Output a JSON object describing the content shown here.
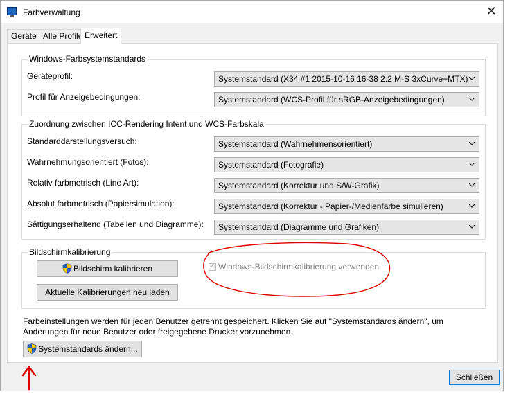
{
  "window": {
    "title": "Farbverwaltung",
    "close_glyph": "✕"
  },
  "tabs": [
    {
      "label": "Geräte"
    },
    {
      "label": "Alle Profile"
    },
    {
      "label": "Erweitert"
    }
  ],
  "wcs_group": {
    "title": "Windows-Farbsystemstandards",
    "rows": [
      {
        "label": "Geräteprofil:",
        "value": "Systemstandard (X34 #1 2015-10-16 16-38 2.2 M-S 3xCurve+MTX)"
      },
      {
        "label": "Profil für Anzeigebedingungen:",
        "value": "Systemstandard (WCS-Profil für sRGB-Anzeigebedingungen)"
      }
    ]
  },
  "icc_group": {
    "title": "Zuordnung zwischen ICC-Rendering Intent und WCS-Farbskala",
    "rows": [
      {
        "label": "Standarddarstellungsversuch:",
        "value": "Systemstandard (Wahrnehmensorientiert)"
      },
      {
        "label": "Wahrnehmungsorientiert (Fotos):",
        "value": "Systemstandard (Fotografie)"
      },
      {
        "label": "Relativ farbmetrisch (Line Art):",
        "value": "Systemstandard (Korrektur und S/W-Grafik)"
      },
      {
        "label": "Absolut farbmetrisch (Papiersimulation):",
        "value": "Systemstandard (Korrektur - Papier-/Medienfarbe simulieren)"
      },
      {
        "label": "Sättigungserhaltend (Tabellen und Diagramme):",
        "value": "Systemstandard (Diagramme und Grafiken)"
      }
    ]
  },
  "calibration_group": {
    "title": "Bildschirmkalibrierung",
    "calibrate_button": "Bildschirm kalibrieren",
    "reload_button": "Aktuelle Kalibrierungen neu laden",
    "use_windows_calibration_label": "Windows-Bildschirmkalibrierung verwenden",
    "use_windows_calibration_checked": true,
    "use_windows_calibration_enabled": false
  },
  "info_text": "Farbeinstellungen werden für jeden Benutzer getrennt gespeichert. Klicken Sie auf \"Systemstandards ändern\", um Änderungen für neue Benutzer oder freigegebene Drucker vorzunehmen.",
  "change_defaults_button": "Systemstandards ändern...",
  "close_button": "Schließen",
  "icons": {
    "shield": "uac-shield-icon",
    "dropdown": "chevron-down-icon",
    "app": "color-management-icon"
  },
  "annotation_color": "#e00000"
}
